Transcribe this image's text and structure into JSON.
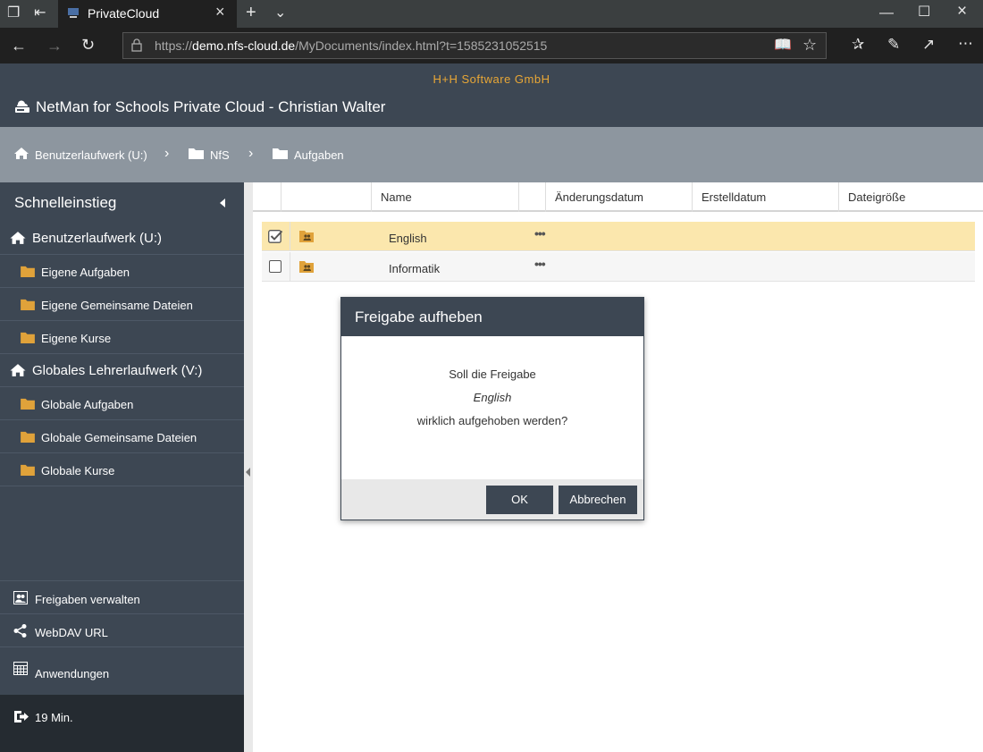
{
  "browser": {
    "tab_title": "PrivateCloud",
    "url_prefix": "https://",
    "url_host": "demo.nfs-cloud.de",
    "url_path": "/MyDocuments/index.html?t=1585231052515"
  },
  "header": {
    "company": "H+H Software GmbH",
    "title": "NetMan for Schools Private Cloud - Christian Walter"
  },
  "breadcrumb": [
    "Benutzerlaufwerk (U:)",
    "NfS",
    "Aufgaben"
  ],
  "sidebar": {
    "heading": "Schnelleinstieg",
    "drive1": "Benutzerlaufwerk (U:)",
    "drive1_items": [
      "Eigene Aufgaben",
      "Eigene Gemeinsame Dateien",
      "Eigene Kurse"
    ],
    "drive2": "Globales Lehrerlaufwerk (V:)",
    "drive2_items": [
      "Globale Aufgaben",
      "Globale Gemeinsame Dateien",
      "Globale Kurse"
    ],
    "shares": "Freigaben verwalten",
    "webdav": "WebDAV URL",
    "apps": "Anwendungen",
    "timer": "19 Min."
  },
  "table": {
    "columns": [
      "Name",
      "Änderungsdatum",
      "Erstelldatum",
      "Dateigröße"
    ],
    "rows": [
      {
        "name": "English",
        "selected": true
      },
      {
        "name": "Informatik",
        "selected": false
      }
    ],
    "more_glyph": "•••"
  },
  "dialog": {
    "title": "Freigabe aufheben",
    "line1": "Soll die Freigabe",
    "item": "English",
    "line3": "wirklich aufgehoben werden?",
    "ok": "OK",
    "cancel": "Abbrechen"
  },
  "colors": {
    "primary": "#3d4753",
    "accent": "#e8a736",
    "selected_row": "#fbe7ad",
    "folder": "#e0a23a"
  }
}
